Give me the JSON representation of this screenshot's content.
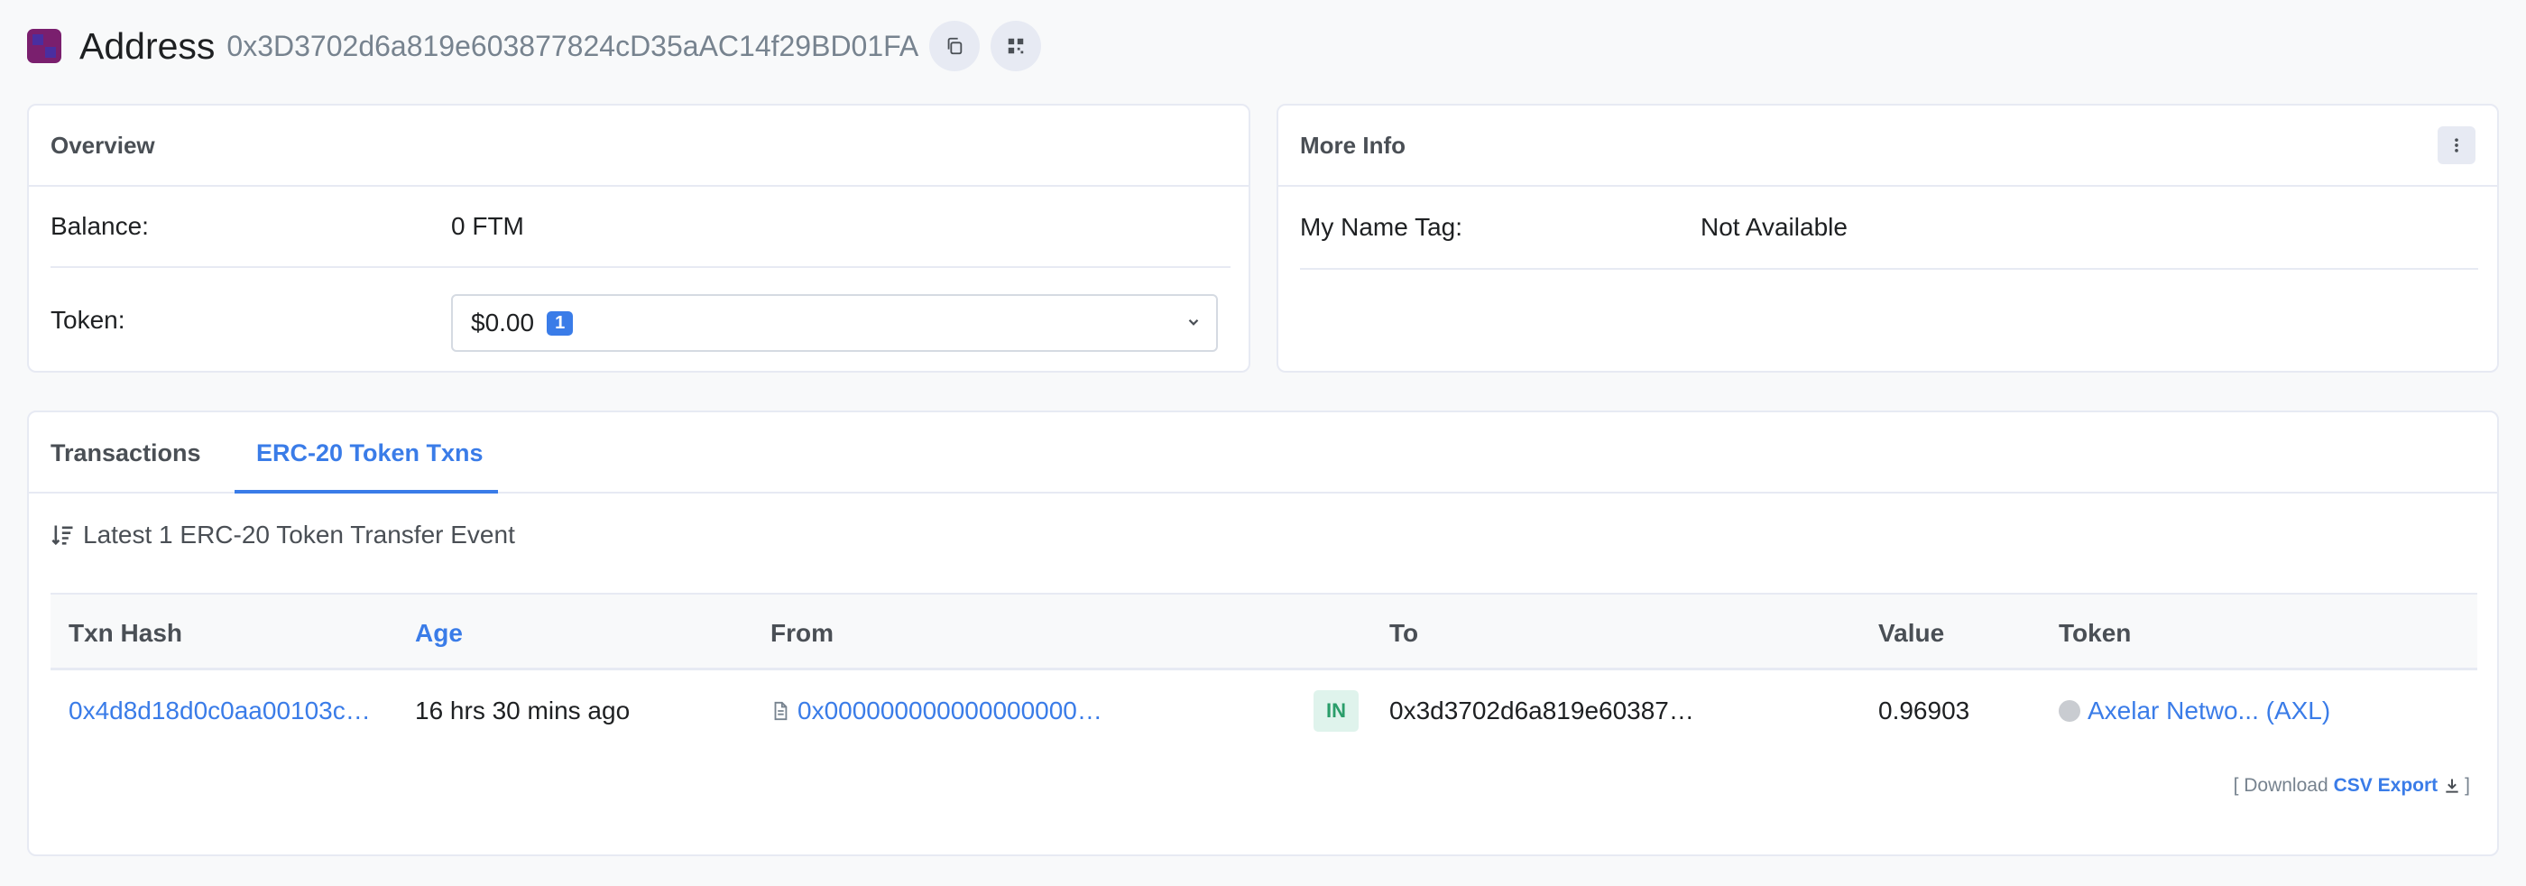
{
  "header": {
    "title": "Address",
    "address": "0x3D3702d6a819e603877824cD35aAC14f29BD01FA",
    "icons": [
      "copy-icon",
      "qr-code-icon"
    ]
  },
  "overview": {
    "title": "Overview",
    "balance_label": "Balance:",
    "balance_value": "0 FTM",
    "token_label": "Token:",
    "token_value": "$0.00",
    "token_count": "1"
  },
  "more_info": {
    "title": "More Info",
    "name_tag_label": "My Name Tag:",
    "name_tag_value": "Not Available"
  },
  "tabs": [
    {
      "label": "Transactions",
      "active": false
    },
    {
      "label": "ERC-20 Token Txns",
      "active": true
    }
  ],
  "table": {
    "summary": "Latest 1 ERC-20 Token Transfer Event",
    "headers": [
      "Txn Hash",
      "Age",
      "From",
      "To",
      "Value",
      "Token"
    ],
    "rows": [
      {
        "txn_hash": "0x4d8d18d0c0aa00103c…",
        "age": "16 hrs 30 mins ago",
        "from": "0x000000000000000000…",
        "direction": "IN",
        "to": "0x3d3702d6a819e60387…",
        "value": "0.96903",
        "token": "Axelar Netwo... (AXL)"
      }
    ],
    "download_prefix": "[ Download",
    "download_link": "CSV Export",
    "download_suffix": "]"
  },
  "colors": {
    "accent": "#3a7ce8",
    "in_badge_bg": "#dff3ec",
    "in_badge_text": "#2a9d6a"
  }
}
